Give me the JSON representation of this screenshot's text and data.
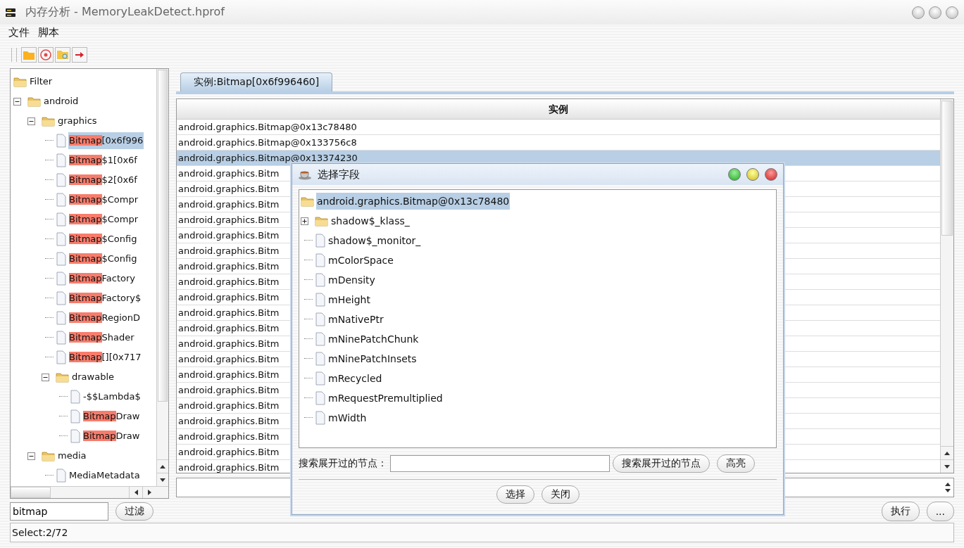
{
  "window": {
    "title": "内存分析 - MemoryLeakDetect.hprof"
  },
  "menu": [
    "文件",
    "脚本"
  ],
  "filter_tree": {
    "items": [
      {
        "label": "Filter",
        "kind": "folder",
        "selected": false,
        "children": [
          {
            "label": "android",
            "kind": "folder",
            "expanded": true,
            "selected": false,
            "children": [
              {
                "label": "graphics",
                "kind": "folder",
                "expanded": true,
                "selected": false,
                "children": [
                  {
                    "match": "Bitmap",
                    "label": "[0x6f996",
                    "kind": "file",
                    "selected": true
                  },
                  {
                    "match": "Bitmap",
                    "label": "$1[0x6f",
                    "kind": "file",
                    "selected": false
                  },
                  {
                    "match": "Bitmap",
                    "label": "$2[0x6f",
                    "kind": "file",
                    "selected": false
                  },
                  {
                    "match": "Bitmap",
                    "label": "$Compr",
                    "kind": "file",
                    "selected": false
                  },
                  {
                    "match": "Bitmap",
                    "label": "$Compr",
                    "kind": "file",
                    "selected": false
                  },
                  {
                    "match": "Bitmap",
                    "label": "$Config",
                    "kind": "file",
                    "selected": false
                  },
                  {
                    "match": "Bitmap",
                    "label": "$Config",
                    "kind": "file",
                    "selected": false
                  },
                  {
                    "match": "Bitmap",
                    "label": "Factory",
                    "kind": "file",
                    "selected": false
                  },
                  {
                    "match": "Bitmap",
                    "label": "Factory$",
                    "kind": "file",
                    "selected": false
                  },
                  {
                    "match": "Bitmap",
                    "label": "RegionD",
                    "kind": "file",
                    "selected": false
                  },
                  {
                    "match": "Bitmap",
                    "label": "Shader",
                    "kind": "file",
                    "selected": false
                  },
                  {
                    "match": "Bitmap",
                    "label": "[][0x717",
                    "kind": "file",
                    "selected": false
                  },
                  {
                    "label": "drawable",
                    "kind": "folder",
                    "expanded": true,
                    "selected": false,
                    "children": [
                      {
                        "label": "-$$Lambda$",
                        "kind": "file",
                        "selected": false
                      },
                      {
                        "match": "Bitmap",
                        "label": "Draw",
                        "kind": "file",
                        "selected": false
                      },
                      {
                        "match": "Bitmap",
                        "label": "Draw",
                        "kind": "file",
                        "selected": false
                      }
                    ]
                  }
                ]
              },
              {
                "label": "media",
                "kind": "folder",
                "expanded": true,
                "selected": false,
                "children": [
                  {
                    "label": "MediaMetadata",
                    "kind": "file",
                    "selected": false
                  }
                ]
              }
            ]
          }
        ]
      }
    ]
  },
  "filter_field": {
    "value": "bitmap"
  },
  "filter_button": "过滤",
  "tabs": [
    {
      "label": "实例:Bitmap[0x6f996460]",
      "selected": true
    }
  ],
  "table": {
    "columns": [
      "实例"
    ],
    "rows": [
      {
        "text": "android.graphics.Bitmap@0x13c78480",
        "selected": false
      },
      {
        "text": "android.graphics.Bitmap@0x133756c8",
        "selected": false
      },
      {
        "text": "android.graphics.Bitmap@0x13374230",
        "selected": true
      },
      {
        "text": "android.graphics.Bitm",
        "selected": false
      },
      {
        "text": "android.graphics.Bitm",
        "selected": false
      },
      {
        "text": "android.graphics.Bitm",
        "selected": false
      },
      {
        "text": "android.graphics.Bitm",
        "selected": false
      },
      {
        "text": "android.graphics.Bitm",
        "selected": false
      },
      {
        "text": "android.graphics.Bitm",
        "selected": false
      },
      {
        "text": "android.graphics.Bitm",
        "selected": false
      },
      {
        "text": "android.graphics.Bitm",
        "selected": false
      },
      {
        "text": "android.graphics.Bitm",
        "selected": false
      },
      {
        "text": "android.graphics.Bitm",
        "selected": false
      },
      {
        "text": "android.graphics.Bitm",
        "selected": false
      },
      {
        "text": "android.graphics.Bitm",
        "selected": false
      },
      {
        "text": "android.graphics.Bitm",
        "selected": false
      },
      {
        "text": "android.graphics.Bitm",
        "selected": false
      },
      {
        "text": "android.graphics.Bitm",
        "selected": false
      },
      {
        "text": "android.graphics.Bitm",
        "selected": false
      },
      {
        "text": "android.graphics.Bitm",
        "selected": false
      },
      {
        "text": "android.graphics.Bitm",
        "selected": false
      },
      {
        "text": "android.graphics.Bitm",
        "selected": false
      },
      {
        "text": "android.graphics.Bitm",
        "selected": false
      }
    ]
  },
  "command_buttons": [
    "执行",
    "..."
  ],
  "status_bar": "Select:2/72",
  "dialog": {
    "title": "选择字段",
    "tree": [
      {
        "label": "android.graphics.Bitmap@0x13c78480",
        "kind": "folder",
        "selected": true,
        "children": [
          {
            "label": "shadow$_klass_",
            "kind": "folder",
            "expanded": false,
            "selected": false
          },
          {
            "label": "shadow$_monitor_",
            "kind": "file",
            "selected": false
          },
          {
            "label": "mColorSpace",
            "kind": "file",
            "selected": false
          },
          {
            "label": "mDensity",
            "kind": "file",
            "selected": false
          },
          {
            "label": "mHeight",
            "kind": "file",
            "selected": false
          },
          {
            "label": "mNativePtr",
            "kind": "file",
            "selected": false
          },
          {
            "label": "mNinePatchChunk",
            "kind": "file",
            "selected": false
          },
          {
            "label": "mNinePatchInsets",
            "kind": "file",
            "selected": false
          },
          {
            "label": "mRecycled",
            "kind": "file",
            "selected": false
          },
          {
            "label": "mRequestPremultiplied",
            "kind": "file",
            "selected": false
          },
          {
            "label": "mWidth",
            "kind": "file",
            "selected": false
          }
        ]
      }
    ],
    "search_label": "搜索展开过的节点：",
    "search_button": "搜索展开过的节点",
    "highlight_button": "高亮",
    "buttons": [
      "选择",
      "关闭"
    ]
  }
}
